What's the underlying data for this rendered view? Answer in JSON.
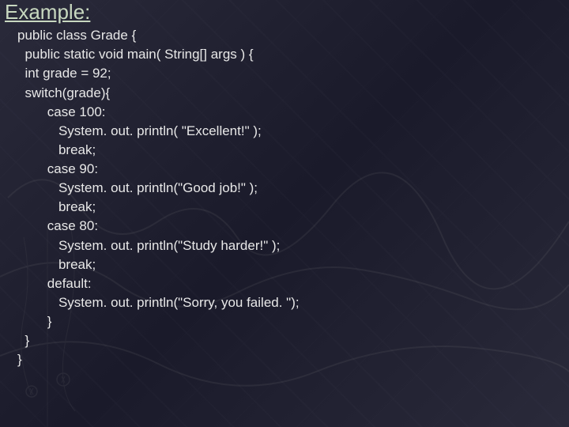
{
  "heading": "Example:",
  "code": {
    "line0": "public class Grade {",
    "line1": "  public static void main( String[] args ) {",
    "line2": "  int grade = 92;",
    "line3": "  switch(grade){",
    "line4": "        case 100:",
    "line5": "           System. out. println( \"Excellent!\" );",
    "line6": "           break;",
    "line7": "        case 90:",
    "line8": "           System. out. println(\"Good job!\" );",
    "line9": "           break;",
    "line10": "        case 80:",
    "line11": "           System. out. println(\"Study harder!\" );",
    "line12": "           break;",
    "line13": "        default:",
    "line14": "           System. out. println(\"Sorry, you failed. \");",
    "line15": "        }",
    "line16": "  }",
    "line17": "}"
  }
}
